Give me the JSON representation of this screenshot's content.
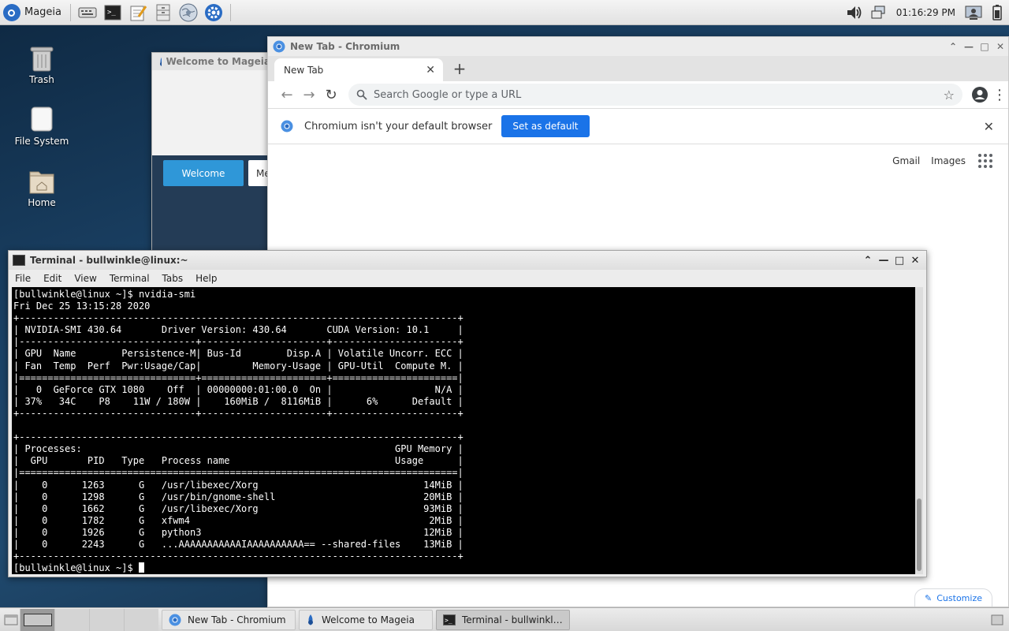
{
  "top_panel": {
    "app_menu_label": "Mageia",
    "launchers": [
      "keyboard-settings-icon",
      "terminal-icon",
      "text-editor-icon",
      "file-cabinet-icon",
      "web-browser-icon",
      "settings-gear-icon"
    ],
    "clock": "01:16:29 PM"
  },
  "desktop_icons": [
    {
      "label": "Trash"
    },
    {
      "label": "File System"
    },
    {
      "label": "Home"
    }
  ],
  "welcome_window": {
    "title": "Welcome to Mageia",
    "button_welcome": "Welcome",
    "button_partial": "Me"
  },
  "chromium": {
    "window_title": "New Tab - Chromium",
    "tab_label": "New Tab",
    "omnibox_placeholder": "Search Google or type a URL",
    "infobar_message": "Chromium isn't your default browser",
    "infobar_button": "Set as default",
    "ntp_link_gmail": "Gmail",
    "ntp_link_images": "Images",
    "customize_label": "Customize"
  },
  "terminal": {
    "window_title": "Terminal - bullwinkle@linux:~",
    "menu": [
      "File",
      "Edit",
      "View",
      "Terminal",
      "Tabs",
      "Help"
    ],
    "lines": [
      "[bullwinkle@linux ~]$ nvidia-smi",
      "Fri Dec 25 13:15:28 2020",
      "+-----------------------------------------------------------------------------+",
      "| NVIDIA-SMI 430.64       Driver Version: 430.64       CUDA Version: 10.1     |",
      "|-------------------------------+----------------------+----------------------+",
      "| GPU  Name        Persistence-M| Bus-Id        Disp.A | Volatile Uncorr. ECC |",
      "| Fan  Temp  Perf  Pwr:Usage/Cap|         Memory-Usage | GPU-Util  Compute M. |",
      "|===============================+======================+======================|",
      "|   0  GeForce GTX 1080    Off  | 00000000:01:00.0  On |                  N/A |",
      "| 37%   34C    P8    11W / 180W |    160MiB /  8116MiB |      6%      Default |",
      "+-------------------------------+----------------------+----------------------+",
      "",
      "+-----------------------------------------------------------------------------+",
      "| Processes:                                                       GPU Memory |",
      "|  GPU       PID   Type   Process name                             Usage      |",
      "|=============================================================================|",
      "|    0      1263      G   /usr/libexec/Xorg                             14MiB |",
      "|    0      1298      G   /usr/bin/gnome-shell                          20MiB |",
      "|    0      1662      G   /usr/libexec/Xorg                             93MiB |",
      "|    0      1782      G   xfwm4                                          2MiB |",
      "|    0      1926      G   python3                                       12MiB |",
      "|    0      2243      G   ...AAAAAAAAAAAIAAAAAAAAAA== --shared-files    13MiB |",
      "+-----------------------------------------------------------------------------+"
    ],
    "prompt": "[bullwinkle@linux ~]$ "
  },
  "taskbar": {
    "tasks": [
      {
        "label": "New Tab - Chromium",
        "icon": "chromium-icon"
      },
      {
        "label": "Welcome to Mageia",
        "icon": "mageia-welcome-icon"
      },
      {
        "label": "Terminal - bullwinkle@linux:~",
        "icon": "terminal-icon"
      }
    ]
  },
  "colors": {
    "accent_blue": "#1a73e8",
    "welcome_button": "#2f97d8",
    "terminal_bg": "#000000"
  }
}
